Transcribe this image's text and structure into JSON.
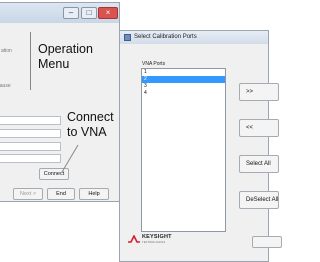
{
  "operation_window": {
    "partial_labels": [
      "ation",
      "pause"
    ],
    "buttons": {
      "connect": "Connect",
      "next": "Next >",
      "end": "End",
      "help": "Help"
    }
  },
  "annotations": {
    "operation_menu": [
      "Operation",
      "Menu"
    ],
    "connect_to_vna": [
      "Connect",
      "to VNA"
    ]
  },
  "dialog": {
    "title": "Select Calibration Ports",
    "list_label": "VNA Ports",
    "ports": [
      "1",
      "2",
      "3",
      "4"
    ],
    "selected_index": 1,
    "buttons": {
      "add": ">>",
      "remove": "<<",
      "select_all": "Select All",
      "deselect_all": "DeSelect All"
    },
    "logo": {
      "name": "KEYSIGHT",
      "tagline": "TECHNOLOGIES"
    }
  },
  "colors": {
    "selection": "#3399ff",
    "logo_red": "#d6202e"
  }
}
